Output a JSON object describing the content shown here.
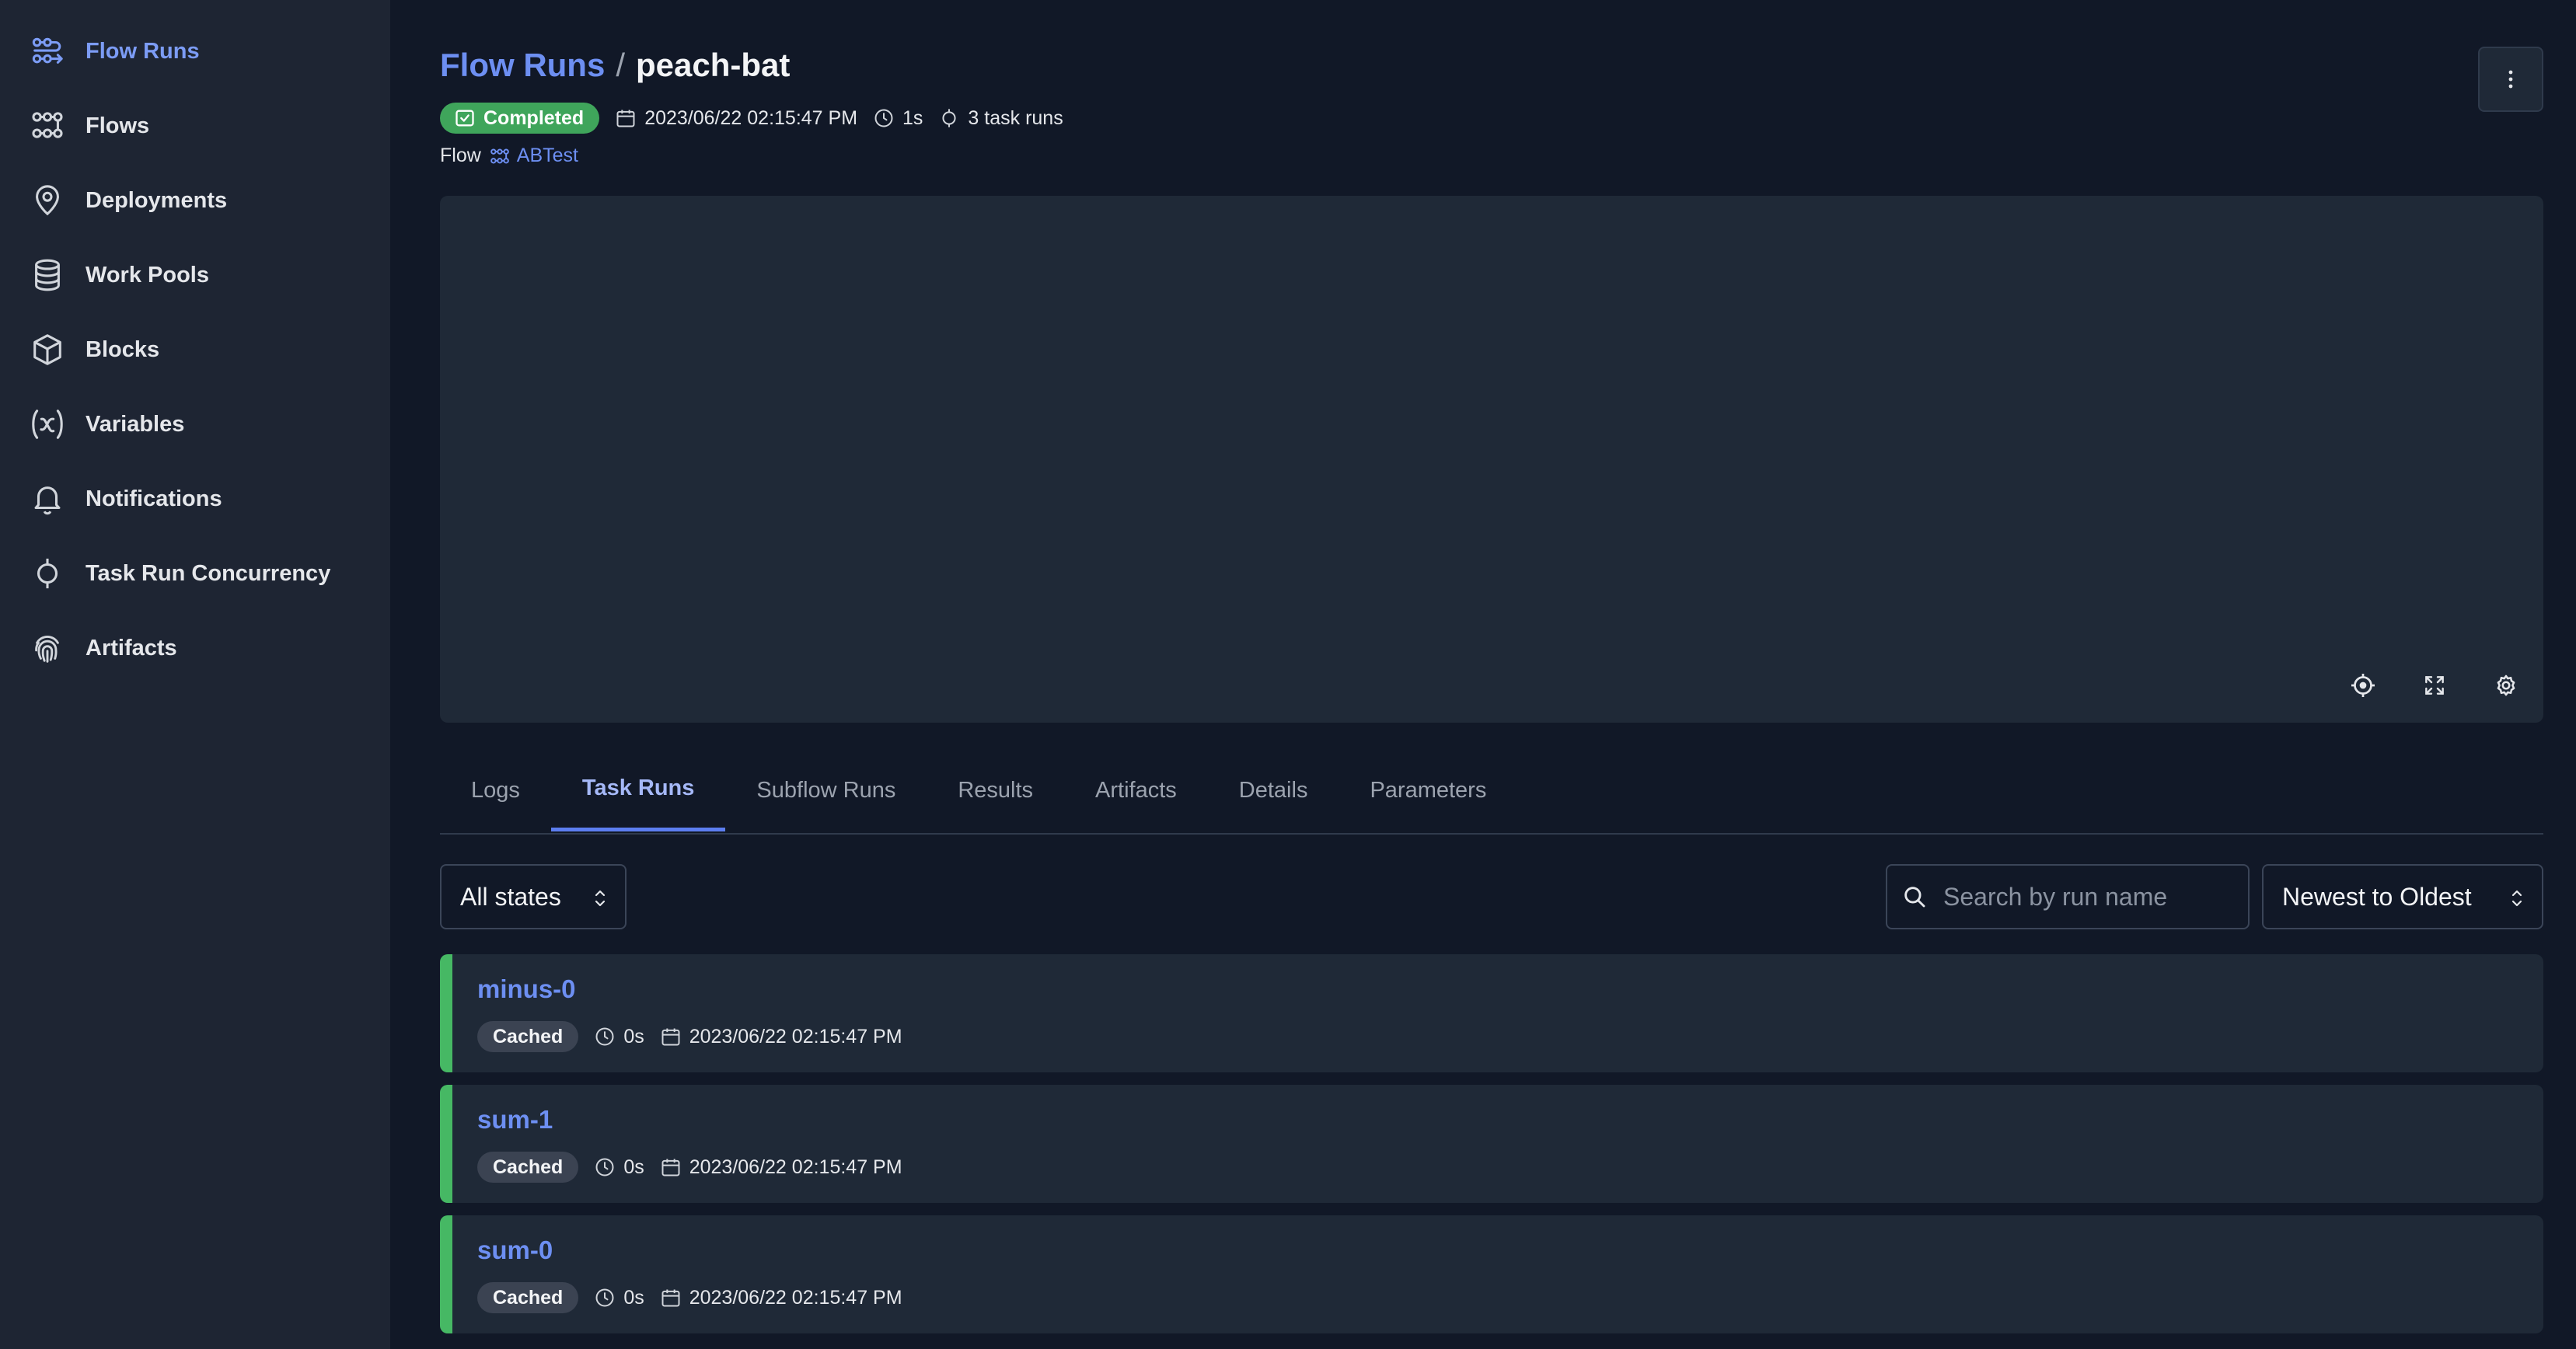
{
  "sidebar": {
    "items": [
      {
        "label": "Flow Runs",
        "icon": "flow-runs-icon",
        "active": true
      },
      {
        "label": "Flows",
        "icon": "flows-icon",
        "active": false
      },
      {
        "label": "Deployments",
        "icon": "map-pin-icon",
        "active": false
      },
      {
        "label": "Work Pools",
        "icon": "database-icon",
        "active": false
      },
      {
        "label": "Blocks",
        "icon": "cube-icon",
        "active": false
      },
      {
        "label": "Variables",
        "icon": "variable-icon",
        "active": false
      },
      {
        "label": "Notifications",
        "icon": "bell-icon",
        "active": false
      },
      {
        "label": "Task Run Concurrency",
        "icon": "concurrency-icon",
        "active": false
      },
      {
        "label": "Artifacts",
        "icon": "fingerprint-icon",
        "active": false
      }
    ]
  },
  "header": {
    "breadcrumb_root": "Flow Runs",
    "breadcrumb_sep": "/",
    "run_name": "peach-bat",
    "state": "Completed",
    "start_time": "2023/06/22 02:15:47 PM",
    "duration": "1s",
    "task_runs": "3 task runs",
    "flow_label": "Flow",
    "flow_name": "ABTest"
  },
  "tabs": [
    {
      "label": "Logs",
      "active": false
    },
    {
      "label": "Task Runs",
      "active": true
    },
    {
      "label": "Subflow Runs",
      "active": false
    },
    {
      "label": "Results",
      "active": false
    },
    {
      "label": "Artifacts",
      "active": false
    },
    {
      "label": "Details",
      "active": false
    },
    {
      "label": "Parameters",
      "active": false
    }
  ],
  "filters": {
    "state_selected": "All states",
    "search_placeholder": "Search by run name",
    "sort_selected": "Newest to Oldest"
  },
  "task_runs": [
    {
      "name": "minus-0",
      "state": "Cached",
      "duration": "0s",
      "start_time": "2023/06/22 02:15:47 PM"
    },
    {
      "name": "sum-1",
      "state": "Cached",
      "duration": "0s",
      "start_time": "2023/06/22 02:15:47 PM"
    },
    {
      "name": "sum-0",
      "state": "Cached",
      "duration": "0s",
      "start_time": "2023/06/22 02:15:47 PM"
    }
  ],
  "colors": {
    "accent": "#6d8ff2",
    "completed": "#3fa55b",
    "cached_bar": "#46b864",
    "background": "#111827",
    "sidebar": "#1e2533"
  }
}
